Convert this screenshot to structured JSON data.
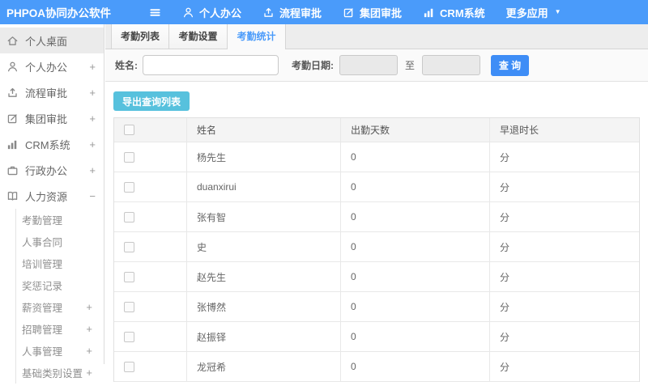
{
  "app": {
    "title": "PHPOA协同办公软件"
  },
  "topnav": {
    "items": [
      {
        "id": "personal-office",
        "icon": "user-icon",
        "label": "个人办公"
      },
      {
        "id": "process-approval",
        "icon": "flow-icon",
        "label": "流程审批"
      },
      {
        "id": "group-approval",
        "icon": "edit-icon",
        "label": "集团审批"
      },
      {
        "id": "crm-system",
        "icon": "chart-icon",
        "label": "CRM系统"
      },
      {
        "id": "more-apps",
        "icon": "",
        "label": "更多应用",
        "caret": "▼"
      }
    ]
  },
  "sidebar": {
    "items": [
      {
        "id": "personal-desktop",
        "icon": "home-icon",
        "label": "个人桌面",
        "active": true,
        "expand": ""
      },
      {
        "id": "personal-office",
        "icon": "user-icon",
        "label": "个人办公",
        "expand": "+"
      },
      {
        "id": "process-approval",
        "icon": "flow-icon",
        "label": "流程审批",
        "expand": "+"
      },
      {
        "id": "group-approval",
        "icon": "edit-icon",
        "label": "集团审批",
        "expand": "+"
      },
      {
        "id": "crm-system",
        "icon": "chart-icon",
        "label": "CRM系统",
        "expand": "+"
      },
      {
        "id": "admin-office",
        "icon": "briefcase-icon",
        "label": "行政办公",
        "expand": "+"
      },
      {
        "id": "hr",
        "icon": "book-icon",
        "label": "人力资源",
        "expand": "−"
      }
    ],
    "hr_children": [
      {
        "id": "attendance-mgmt",
        "label": "考勤管理",
        "expand": ""
      },
      {
        "id": "personnel-contract",
        "label": "人事合同",
        "expand": ""
      },
      {
        "id": "training-mgmt",
        "label": "培训管理",
        "expand": ""
      },
      {
        "id": "reward-punishment",
        "label": "奖惩记录",
        "expand": ""
      },
      {
        "id": "salary-mgmt",
        "label": "薪资管理",
        "expand": "+"
      },
      {
        "id": "recruit-mgmt",
        "label": "招聘管理",
        "expand": "+"
      },
      {
        "id": "personnel-mgmt",
        "label": "人事管理",
        "expand": "+"
      },
      {
        "id": "base-category",
        "label": "基础类别设置",
        "expand": "+"
      }
    ]
  },
  "tabs": [
    {
      "id": "attendance-list",
      "label": "考勤列表",
      "active": false
    },
    {
      "id": "attendance-settings",
      "label": "考勤设置",
      "active": false
    },
    {
      "id": "attendance-stats",
      "label": "考勤统计",
      "active": true
    }
  ],
  "filters": {
    "name_label": "姓名:",
    "name_value": "",
    "date_label": "考勤日期:",
    "date_from": "",
    "to_label": "至",
    "date_to": "",
    "search_label": "查 询"
  },
  "toolbar": {
    "export_label": "导出查询列表"
  },
  "table": {
    "headers": {
      "name": "姓名",
      "days": "出勤天数",
      "early": "早退时长"
    },
    "rows": [
      {
        "name": "杨先生",
        "days": "0",
        "early": "分"
      },
      {
        "name": "duanxirui",
        "days": "0",
        "early": "分"
      },
      {
        "name": "张有智",
        "days": "0",
        "early": "分"
      },
      {
        "name": "史",
        "days": "0",
        "early": "分"
      },
      {
        "name": "赵先生",
        "days": "0",
        "early": "分"
      },
      {
        "name": "张博然",
        "days": "0",
        "early": "分"
      },
      {
        "name": "赵振铎",
        "days": "0",
        "early": "分"
      },
      {
        "name": "龙冠希",
        "days": "0",
        "early": "分"
      }
    ]
  },
  "colors": {
    "topbar": "#4a9bfa",
    "accent_blue": "#4a9bfa",
    "search_button": "#3e8df6",
    "export_button": "#57c1dd"
  }
}
